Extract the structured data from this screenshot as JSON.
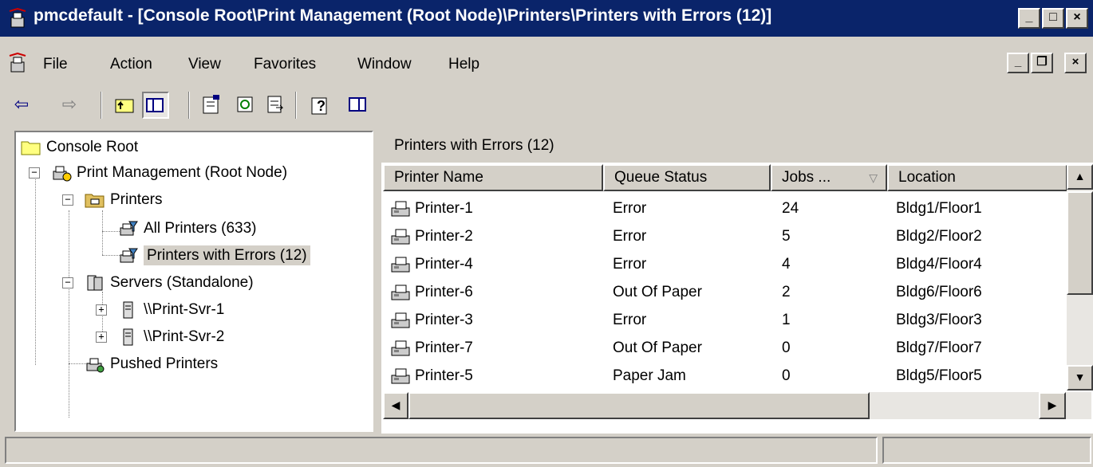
{
  "window": {
    "title": "pmcdefault - [Console Root\\Print Management (Root Node)\\Printers\\Printers with Errors (12)]",
    "controls": {
      "minimize": "_",
      "maximize": "□",
      "close": "×"
    }
  },
  "menu": {
    "items": [
      "File",
      "Action",
      "View",
      "Favorites",
      "Window",
      "Help"
    ],
    "mdi_controls": {
      "minimize": "_",
      "restore": "❐",
      "close": "×"
    }
  },
  "toolbar": {
    "back": "⇦",
    "forward": "⇨",
    "up": "⬑",
    "show_hide_tree": "▤",
    "properties": "☰",
    "refresh": "↻",
    "export": "⎘",
    "help": "?",
    "show_action_pane": "▣"
  },
  "tree": {
    "console_root": "Console Root",
    "print_management": "Print Management (Root Node)",
    "printers": "Printers",
    "all_printers": "All Printers (633)",
    "printers_with_errors": "Printers with Errors (12)",
    "servers": "Servers (Standalone)",
    "server1": "\\\\Print-Svr-1",
    "server2": "\\\\Print-Svr-2",
    "pushed_printers": "Pushed Printers",
    "expand_minus": "−",
    "expand_plus": "+"
  },
  "list": {
    "header_title": "Printers with Errors (12)",
    "columns": {
      "printer_name": "Printer Name",
      "queue_status": "Queue Status",
      "jobs": "Jobs ...",
      "jobs_sort": "▽",
      "location": "Location"
    },
    "rows": [
      {
        "name": "Printer-1",
        "status": "Error",
        "jobs": "24",
        "location": "Bldg1/Floor1"
      },
      {
        "name": "Printer-2",
        "status": "Error",
        "jobs": "5",
        "location": "Bldg2/Floor2"
      },
      {
        "name": "Printer-4",
        "status": "Error",
        "jobs": "4",
        "location": "Bldg4/Floor4"
      },
      {
        "name": "Printer-6",
        "status": "Out Of Paper",
        "jobs": "2",
        "location": "Bldg6/Floor6"
      },
      {
        "name": "Printer-3",
        "status": "Error",
        "jobs": "1",
        "location": "Bldg3/Floor3"
      },
      {
        "name": "Printer-7",
        "status": "Out Of Paper",
        "jobs": "0",
        "location": "Bldg7/Floor7"
      },
      {
        "name": "Printer-5",
        "status": "Paper Jam",
        "jobs": "0",
        "location": "Bldg5/Floor5"
      }
    ]
  },
  "scrollbars": {
    "up": "▲",
    "down": "▼",
    "left": "◀",
    "right": "▶"
  },
  "status": {
    "left": "",
    "right": ""
  },
  "colors": {
    "titlebar": "#0a246a",
    "face": "#d4d0c8",
    "selection": "#d4d0c8"
  }
}
